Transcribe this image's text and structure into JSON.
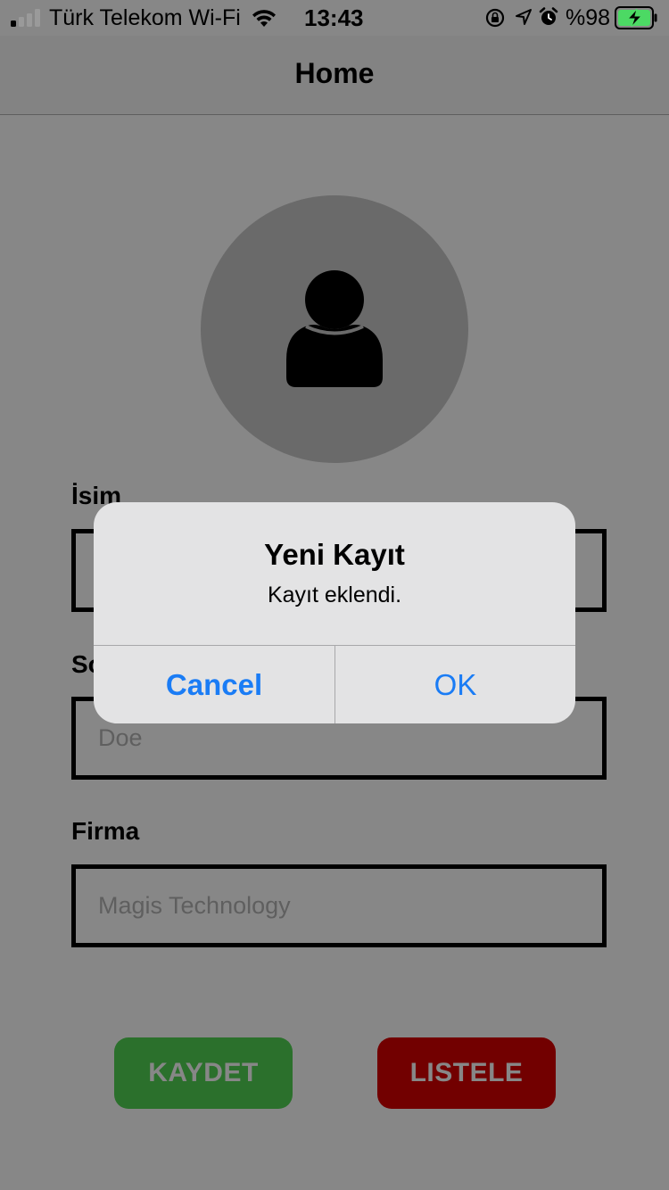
{
  "status_bar": {
    "carrier": "Türk Telekom Wi-Fi",
    "time": "13:43",
    "battery_percent": "%98",
    "icons": [
      "signal-icon",
      "wifi-icon",
      "rotation-lock-icon",
      "location-icon",
      "alarm-icon",
      "battery-charging-icon"
    ]
  },
  "nav": {
    "title": "Home"
  },
  "avatar": {
    "icon": "person-icon"
  },
  "form": {
    "name_label": "İsim",
    "name_placeholder": "",
    "surname_label": "Soyisim",
    "surname_placeholder": "Doe",
    "company_label": "Firma",
    "company_placeholder": "Magis Technology"
  },
  "buttons": {
    "save": "KAYDET",
    "list": "LISTELE"
  },
  "alert": {
    "title": "Yeni Kayıt",
    "message": "Kayıt eklendi.",
    "cancel": "Cancel",
    "ok": "OK"
  },
  "colors": {
    "save_button": "#52d454",
    "list_button": "#d80000",
    "alert_action": "#1a7cf5",
    "dim_overlay": "rgba(0,0,0,0.47)"
  }
}
